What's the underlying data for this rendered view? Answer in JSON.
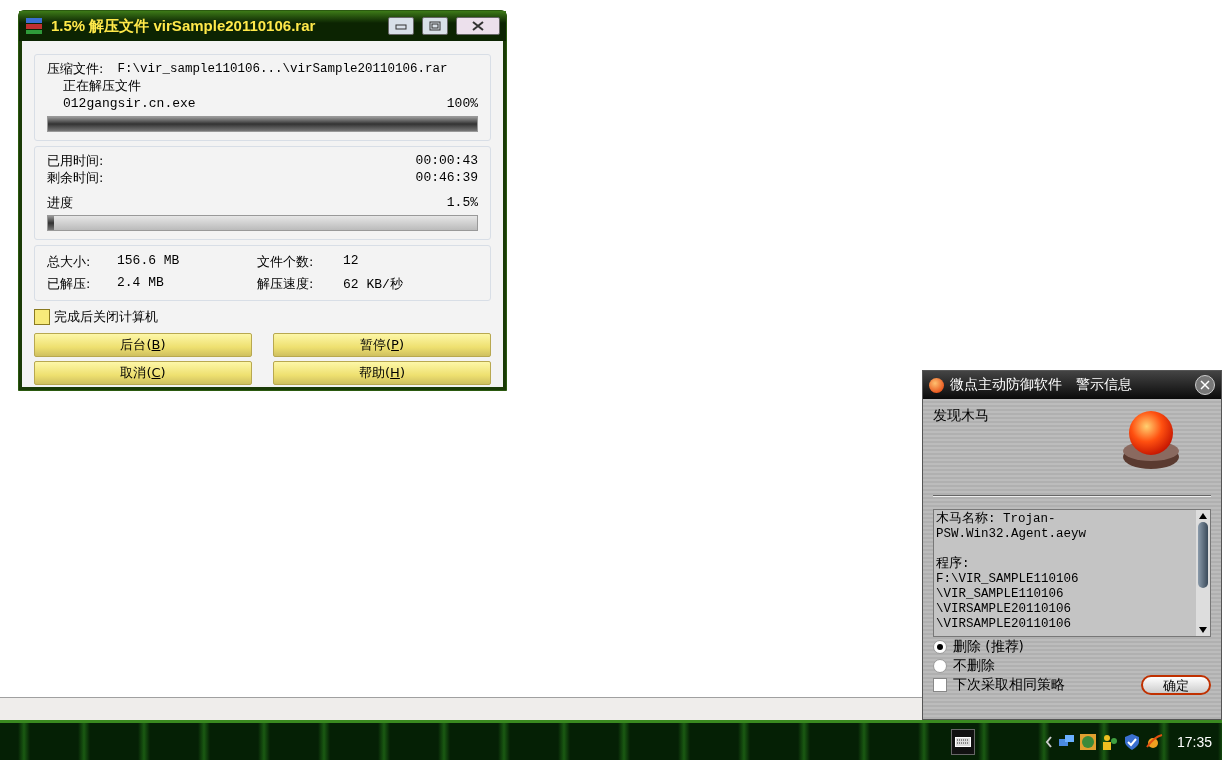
{
  "rar_window": {
    "title": "1.5% 解压文件 virSample20110106.rar",
    "archive_label": "压缩文件:",
    "archive_path": "F:\\vir_sample110106...\\virSample20110106.rar",
    "status": "正在解压文件",
    "current_file": "012gangsir.cn.exe",
    "file_percent": "100%",
    "file_progress": {
      "level": 1
    },
    "elapsed_label": "已用时间:",
    "elapsed": "00:00:43",
    "remaining_label": "剩余时间:",
    "remaining": "00:46:39",
    "progress_label": "进度",
    "progress_percent": "1.5%",
    "progress": {
      "level": 0.015
    },
    "stats": [
      {
        "label": "总大小:",
        "value": "156.6 MB"
      },
      {
        "label": "文件个数:",
        "value": "12"
      },
      {
        "label": "已解压:",
        "value": "2.4 MB"
      },
      {
        "label": "解压速度:",
        "value": "62 KB/秒"
      }
    ],
    "shutdown_checkbox": {
      "label": "完成后关闭计算机",
      "checked": false
    },
    "buttons": [
      {
        "label": "后台(",
        "key": "B",
        "end": ")"
      },
      {
        "label": "暂停(",
        "key": "P",
        "end": ")"
      },
      {
        "label": "取消(",
        "key": "C",
        "end": ")"
      },
      {
        "label": "帮助(",
        "key": "H",
        "end": ")"
      }
    ]
  },
  "alert_window": {
    "title": "微点主动防御软件　警示信息",
    "heading": "发现木马",
    "details": [
      [
        "木马名称: Trojan-",
        "PSW.Win32.Agent.aeyw"
      ],
      [
        "程序:",
        "F:\\VIR_SAMPLE110106",
        "\\VIR_SAMPLE110106",
        "\\VIRSAMPLE20110106",
        "\\VIRSAMPLE20110106"
      ]
    ],
    "options": [
      {
        "label": "删除 (推荐)",
        "selected": true
      },
      {
        "label": "不删除",
        "selected": false
      }
    ],
    "remember_checkbox": {
      "label": "下次采取相同策略",
      "checked": false
    },
    "ok_button": "确定"
  },
  "taskbar": {
    "clock": "17:35"
  }
}
